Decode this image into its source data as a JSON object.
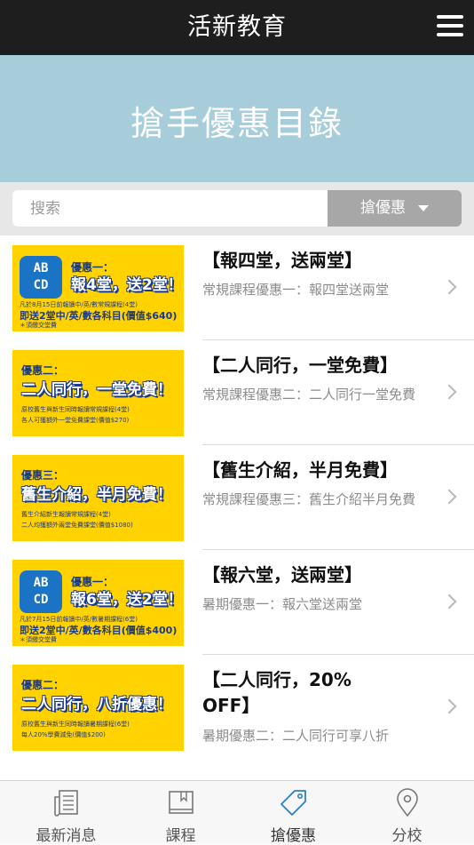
{
  "header": {
    "title": "活新教育",
    "menu_icon": "hamburger-menu-icon"
  },
  "banner": {
    "title": "搶手優惠目錄"
  },
  "search": {
    "placeholder": "搜索",
    "filter_label": "搶優惠"
  },
  "items": [
    {
      "title": "【報四堂，送兩堂】",
      "subtitle": "常規課程優惠一：報四堂送兩堂",
      "thumb": {
        "tag": "優惠一：",
        "headline": "報4堂，送2堂！",
        "line1": "凡於8月15日前報讀中/英/數常規課程(4堂)",
        "line2": "即送2堂中/英/數各科目(價值$640)",
        "note": "＊須繳交堂費",
        "logo": "AB CD"
      }
    },
    {
      "title": "【二人同行，一堂免費】",
      "subtitle": "常規課程優惠二：二人同行一堂免費",
      "thumb": {
        "tag": "優惠二：",
        "headline": "二人同行，一堂免費！",
        "line1": "原校舊生與新生同時報讀常規課程(4堂)",
        "line2": "各人可獲額外一堂免費課堂(價值$270)"
      }
    },
    {
      "title": "【舊生介紹，半月免費】",
      "subtitle": "常規課程優惠三：舊生介紹半月免費",
      "thumb": {
        "tag": "優惠三：",
        "headline": "舊生介紹，半月免費！",
        "line1": "舊生介紹新生報讀常規課程(4堂)",
        "line2": "二人均獲額外兩堂免費課堂(價值$1080)"
      }
    },
    {
      "title": "【報六堂，送兩堂】",
      "subtitle": "暑期優惠一：報六堂送兩堂",
      "thumb": {
        "tag": "優惠一：",
        "headline": "報6堂，送2堂！",
        "line1": "凡於7月15日前報讀中/英/數暑期課程(6堂)",
        "line2": "即送2堂中/英/數各科目(價值$400)",
        "note": "＊須繳交堂費",
        "logo": "AB CD"
      }
    },
    {
      "title": "【二人同行，20% OFF】",
      "subtitle": "暑期優惠二：二人同行可享八折",
      "thumb": {
        "tag": "優惠二：",
        "headline": "二人同行，八折優惠！",
        "line1": "原校舊生與新生同時報讀暑期課程(6堂)",
        "line2": "每人20%學費減免(價值$200)"
      }
    }
  ],
  "tabs": [
    {
      "label": "最新消息",
      "icon": "news-icon",
      "active": false
    },
    {
      "label": "課程",
      "icon": "book-icon",
      "active": false
    },
    {
      "label": "搶優惠",
      "icon": "tag-icon",
      "active": true
    },
    {
      "label": "分校",
      "icon": "location-pin-icon",
      "active": false
    }
  ],
  "colors": {
    "topbar": "#1e1e1e",
    "banner": "#a6cdd9",
    "thumb_bg": "#ffd200",
    "accent_blue": "#1a73c5",
    "active_tab": "#2a7fc9"
  }
}
